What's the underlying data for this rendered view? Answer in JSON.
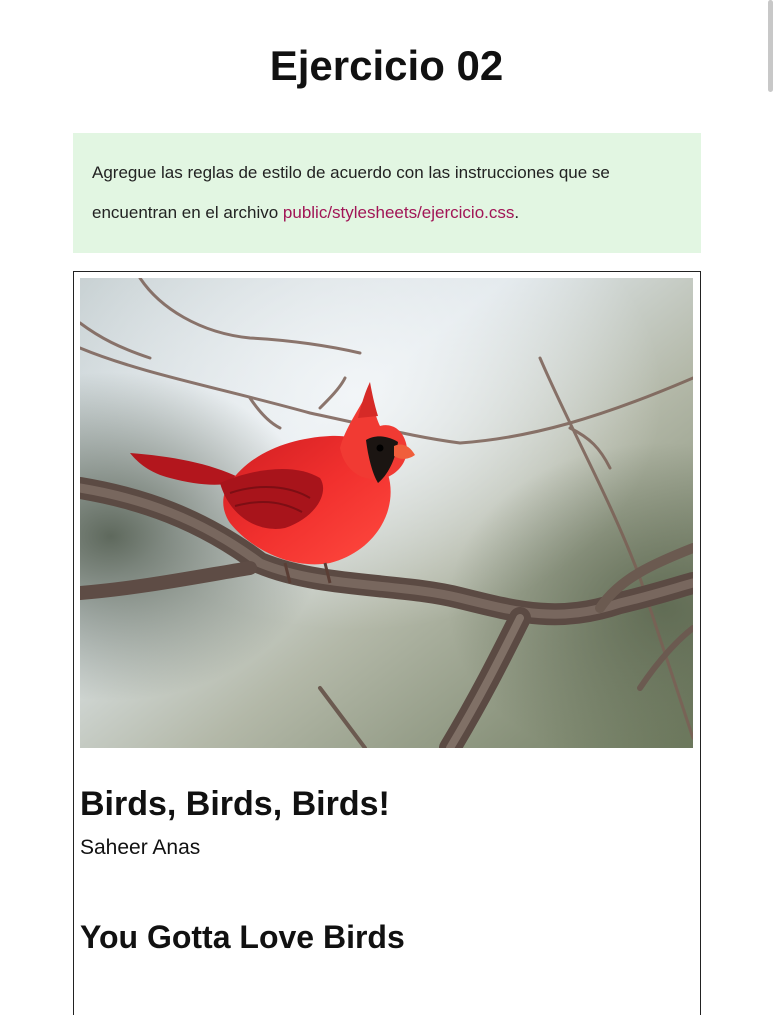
{
  "page": {
    "title": "Ejercicio 02"
  },
  "instructions": {
    "text_before": "Agregue las reglas de estilo de acuerdo con las instrucciones que se encuentran en el archivo ",
    "file_path": "public/stylesheets/ejercicio.css",
    "text_after": "."
  },
  "card": {
    "image_alt": "Northern cardinal perched on a branch",
    "title": "Birds, Birds, Birds!",
    "author": "Saheer Anas",
    "section_title": "You Gotta Love Birds"
  },
  "colors": {
    "instructions_bg": "#e2f6e2",
    "code_text": "#a11556",
    "cardinal_red": "#e8262a"
  }
}
